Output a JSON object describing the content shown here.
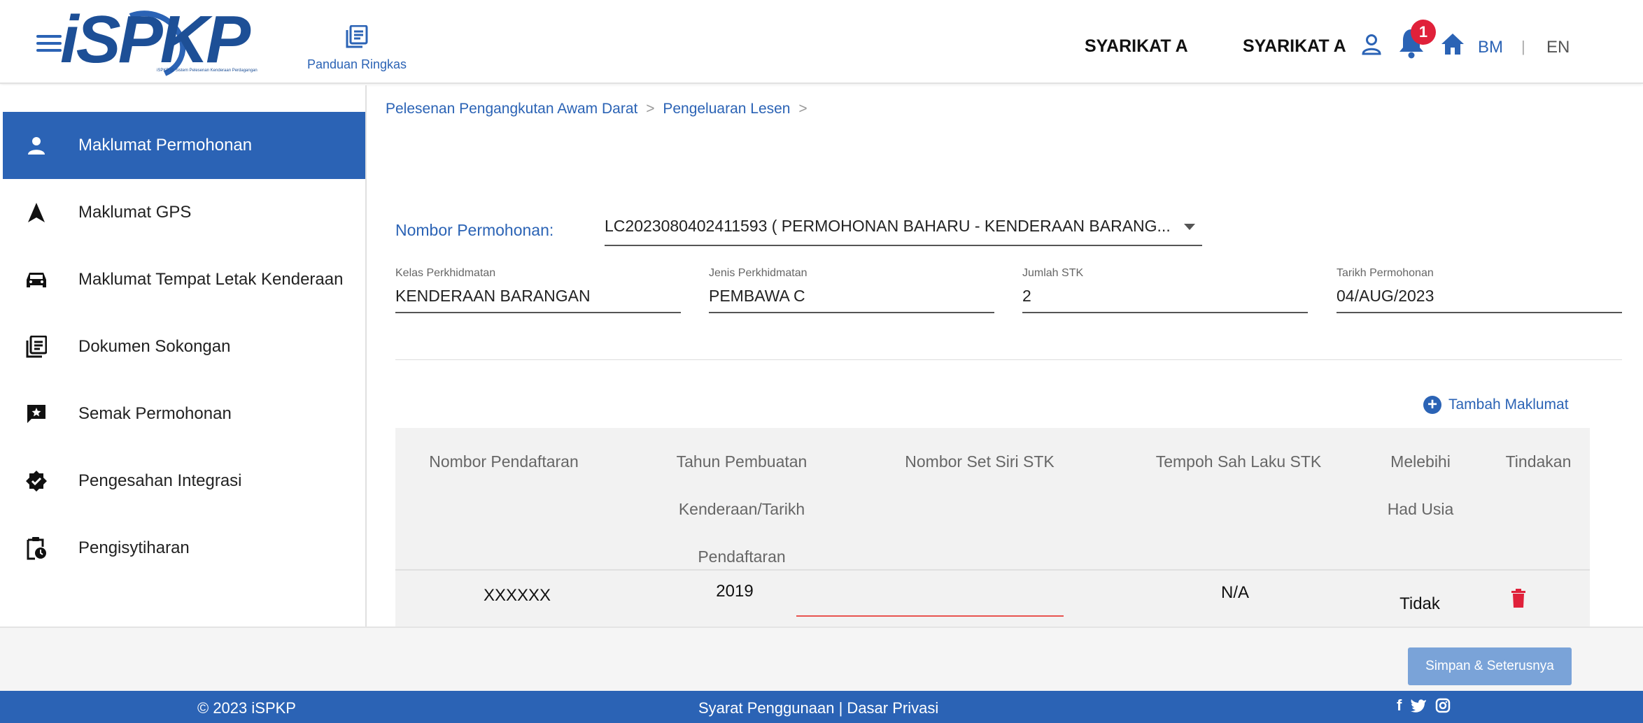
{
  "header": {
    "logo_text": "iSPKP",
    "logo_subtext": "iSPKP @ Sistem Pelesenan Kenderaan Perdagangan",
    "guide_label": "Panduan Ringkas",
    "company_primary": "SYARIKAT A",
    "company_secondary": "SYARIKAT A",
    "notification_count": "1",
    "lang_bm": "BM",
    "lang_separator": "|",
    "lang_en": "EN"
  },
  "sidebar": {
    "items": [
      {
        "label": "Maklumat Permohonan",
        "icon": "person-icon",
        "active": true
      },
      {
        "label": "Maklumat GPS",
        "icon": "navigation-arrow-icon",
        "active": false
      },
      {
        "label": "Maklumat Tempat Letak Kenderaan",
        "icon": "car-icon",
        "active": false
      },
      {
        "label": "Dokumen Sokongan",
        "icon": "document-stack-icon",
        "active": false
      },
      {
        "label": "Semak Permohonan",
        "icon": "review-comment-icon",
        "active": false
      },
      {
        "label": "Pengesahan Integrasi",
        "icon": "verified-badge-icon",
        "active": false
      },
      {
        "label": "Pengisytiharan",
        "icon": "clipboard-clock-icon",
        "active": false
      }
    ]
  },
  "breadcrumb": {
    "level1": "Pelesenan Pengangkutan Awam Darat",
    "level2": "Pengeluaran Lesen",
    "separator": ">"
  },
  "form": {
    "application_label": "Nombor Permohonan:",
    "application_value": "LC2023080402411593 ( PERMOHONAN BAHARU - KENDERAAN BARANG...",
    "fields": [
      {
        "label": "Kelas Perkhidmatan",
        "value": "KENDERAAN BARANGAN"
      },
      {
        "label": "Jenis Perkhidmatan",
        "value": "PEMBAWA C"
      },
      {
        "label": "Jumlah STK",
        "value": "2"
      },
      {
        "label": "Tarikh Permohonan",
        "value": "04/AUG/2023"
      }
    ]
  },
  "table": {
    "add_label": "Tambah Maklumat",
    "headers": {
      "reg_no": "Nombor Pendaftaran",
      "year_line1": "Tahun Pembuatan",
      "year_line2": "Kenderaan/Tarikh",
      "year_line3": "Pendaftaran",
      "stk_serial": "Nombor Set Siri STK",
      "stk_validity": "Tempoh Sah Laku STK",
      "age_line1": "Melebihi",
      "age_line2": "Had Usia",
      "action": "Tindakan"
    },
    "rows": [
      {
        "reg_no": "XXXXXX",
        "year": "2019",
        "stk_serial": "",
        "stk_validity": "N/A",
        "over_age": "Tidak"
      }
    ]
  },
  "actions": {
    "save_next": "Simpan & Seterusnya"
  },
  "footer": {
    "copyright": "© 2023 iSPKP",
    "links": "Syarat Penggunaan | Dasar Privasi",
    "social_facebook": "f",
    "social_twitter": "t",
    "social_instagram": "ig"
  },
  "colors": {
    "primary": "#2b63b5",
    "badge": "#e0213a",
    "danger": "#e0213a",
    "button_disabled": "#7aa3d8"
  }
}
